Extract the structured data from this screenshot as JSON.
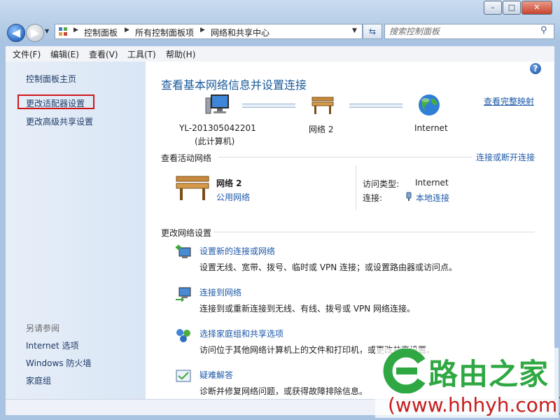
{
  "window": {
    "caption_buttons": {
      "minimize": "–",
      "maximize": "□",
      "close": "✕"
    }
  },
  "address_bar": {
    "breadcrumb": [
      "控制面板",
      "所有控制面板项",
      "网络和共享中心"
    ]
  },
  "search": {
    "placeholder": "搜索控制面板"
  },
  "menu": [
    "文件(F)",
    "编辑(E)",
    "查看(V)",
    "工具(T)",
    "帮助(H)"
  ],
  "sidebar": {
    "home": "控制面板主页",
    "links": [
      "更改适配器设置",
      "更改高级共享设置"
    ],
    "see_also_title": "另请参阅",
    "see_also": [
      "Internet 选项",
      "Windows 防火墙",
      "家庭组"
    ]
  },
  "main": {
    "title": "查看基本网络信息并设置连接",
    "full_map": "查看完整映射",
    "map": {
      "computer_name": "YL-201305042201",
      "computer_sub": "(此计算机)",
      "network": "网络  2",
      "internet": "Internet"
    },
    "active_section": {
      "title": "查看活动网络",
      "action": "连接或断开连接",
      "network_name": "网络  2",
      "network_type": "公用网络",
      "access_label": "访问类型:",
      "access_value": "Internet",
      "conn_label": "连接:",
      "conn_value": "本地连接"
    },
    "change_section": {
      "title": "更改网络设置",
      "items": [
        {
          "label": "设置新的连接或网络",
          "desc": "设置无线、宽带、拨号、临时或 VPN 连接；或设置路由器或访问点。"
        },
        {
          "label": "连接到网络",
          "desc": "连接到或重新连接到无线、有线、拨号或 VPN 网络连接。"
        },
        {
          "label": "选择家庭组和共享选项",
          "desc": "访问位于其他网络计算机上的文件和打印机，或更改共享设置。"
        },
        {
          "label": "疑难解答",
          "desc": "诊断并修复网络问题，或获得故障排除信息。"
        }
      ]
    }
  },
  "watermark": {
    "brand": "路由之家",
    "url": "(www.hhhyh.com)"
  },
  "colors": {
    "link": "#1d58a7",
    "heading": "#1a5a9a",
    "highlight_box": "#d0161b",
    "watermark_green": "#2fa843"
  }
}
